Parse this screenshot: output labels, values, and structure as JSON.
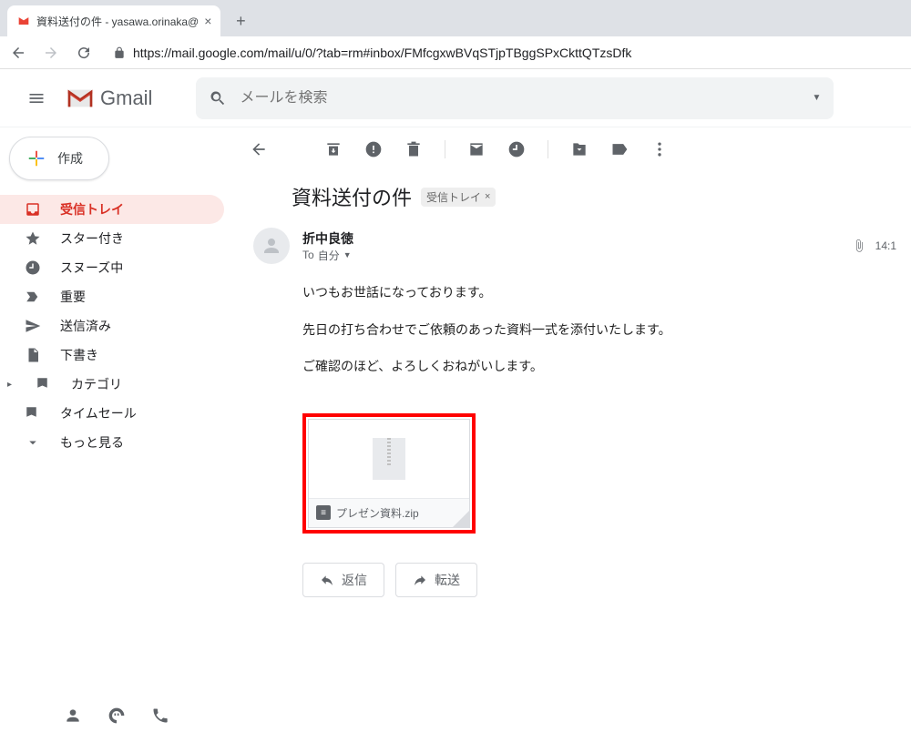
{
  "browser": {
    "tab_title": "資料送付の件 - yasawa.orinaka@",
    "url": "https://mail.google.com/mail/u/0/?tab=rm#inbox/FMfcgxwBVqSTjpTBggSPxCkttQTzsDfk"
  },
  "header": {
    "product": "Gmail",
    "search_placeholder": "メールを検索"
  },
  "compose_label": "作成",
  "sidebar": {
    "items": [
      {
        "label": "受信トレイ"
      },
      {
        "label": "スター付き"
      },
      {
        "label": "スヌーズ中"
      },
      {
        "label": "重要"
      },
      {
        "label": "送信済み"
      },
      {
        "label": "下書き"
      },
      {
        "label": "カテゴリ"
      },
      {
        "label": "タイムセール"
      },
      {
        "label": "もっと見る"
      }
    ]
  },
  "message": {
    "subject": "資料送付の件",
    "label_chip": "受信トレイ",
    "sender": "折中良徳",
    "to_prefix": "To",
    "to_value": "自分",
    "time": "14:1",
    "body_lines": [
      "いつもお世話になっております。",
      "先日の打ち合わせでご依頼のあった資料一式を添付いたします。",
      "ご確認のほど、よろしくおねがいします。"
    ],
    "attachment_name": "プレゼン資料.zip"
  },
  "actions": {
    "reply": "返信",
    "forward": "転送"
  }
}
